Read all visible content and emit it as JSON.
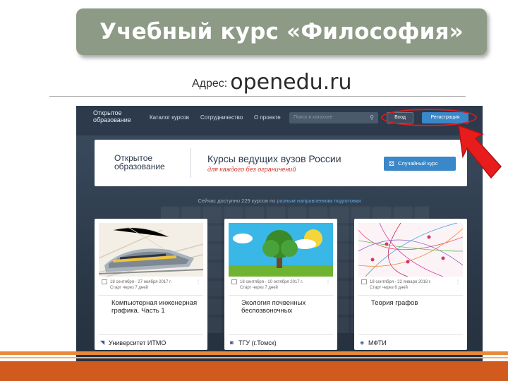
{
  "slide": {
    "title": "Учебный курс «Философия»",
    "address_label": "Адрес:",
    "address_url": "openedu.ru"
  },
  "site": {
    "logo": "Открытое образование",
    "nav": [
      "Каталог курсов",
      "Сотрудничество",
      "О проекте"
    ],
    "search_placeholder": "Поиск в каталоге",
    "login_label": "Вход",
    "register_label": "Регистрация",
    "banner_logo": "Открытое образование",
    "banner_heading": "Курсы ведущих вузов России",
    "banner_subheading": "для каждого без ограничений",
    "random_course_label": "Случайный курс",
    "available_prefix": "Сейчас доступно 229 курсов по",
    "available_link": "разным направлениям подготовки"
  },
  "courses": [
    {
      "dates": "18 сентября - 27 ноября 2017 г.",
      "start": "Старт через 7 дней",
      "title": "Компьютерная инженерная графика. Часть 1",
      "university": "Университет ИТМО"
    },
    {
      "dates": "18 сентября - 10 октября 2017 г.",
      "start": "Старт через 7 дней",
      "title": "Экология почвенных беспозвоночных",
      "university": "ТГУ (г.Томск)"
    },
    {
      "dates": "18 сентября - 22 января 2018 г.",
      "start": "Старт через 6 дней",
      "title": "Теория графов",
      "university": "МФТИ"
    }
  ],
  "colors": {
    "title_box": "#8d9a86",
    "highlight": "#e11b1b",
    "accent_bar": "#d15a1e"
  },
  "icons": [
    "search-icon",
    "calendar-icon",
    "dice-icon",
    "red-arrow-icon",
    "more-icon"
  ]
}
